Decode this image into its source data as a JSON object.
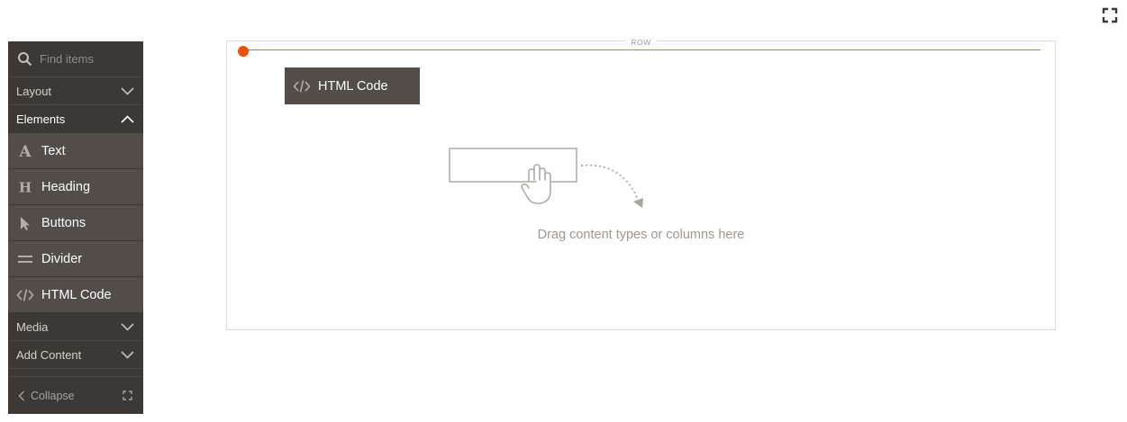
{
  "toolbar": {
    "fullscreen_icon": "fullscreen-icon"
  },
  "sidebar": {
    "search": {
      "placeholder": "Find items",
      "value": ""
    },
    "groups": [
      {
        "label": "Layout",
        "expanded": false
      },
      {
        "label": "Elements",
        "expanded": true,
        "items": [
          {
            "label": "Text",
            "icon": "text-icon"
          },
          {
            "label": "Heading",
            "icon": "heading-icon"
          },
          {
            "label": "Buttons",
            "icon": "cursor-arrow-icon"
          },
          {
            "label": "Divider",
            "icon": "divider-icon"
          },
          {
            "label": "HTML Code",
            "icon": "code-icon"
          }
        ]
      },
      {
        "label": "Media",
        "expanded": false
      },
      {
        "label": "Add Content",
        "expanded": false
      }
    ],
    "collapse_label": "Collapse"
  },
  "stage": {
    "row_label": "ROW",
    "dragging_item": {
      "label": "HTML Code",
      "icon": "code-icon"
    },
    "empty_placeholder": "Drag content types or columns here"
  },
  "colors": {
    "sidebar_bg": "#3b3835",
    "sidebar_item_bg": "#524d49",
    "accent": "#eb5202",
    "row_line": "#c4841e"
  }
}
